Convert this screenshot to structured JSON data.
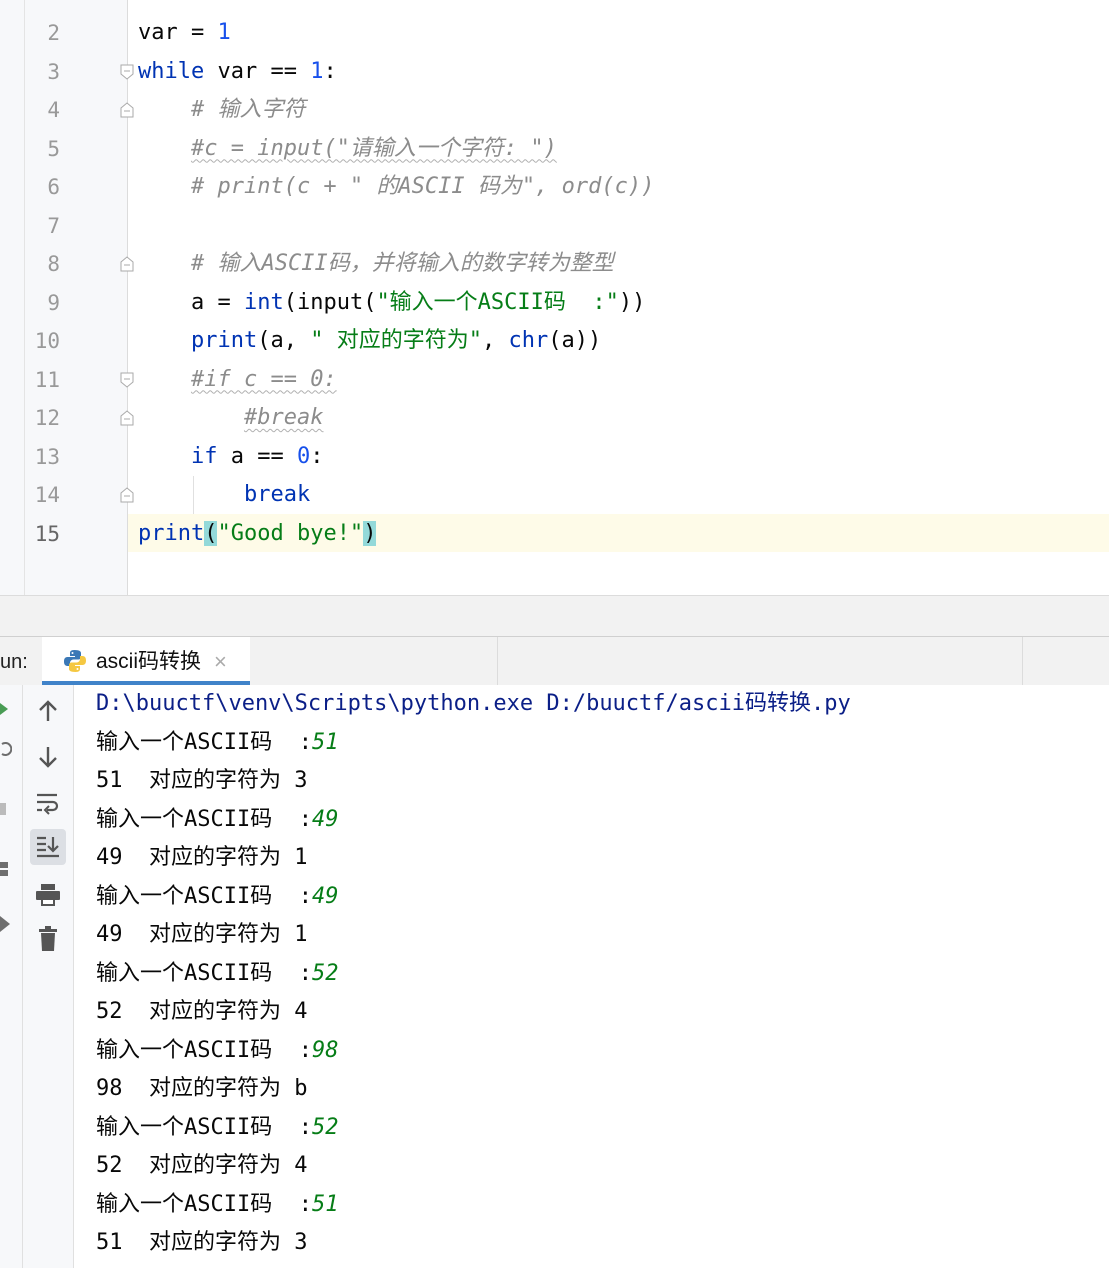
{
  "editor": {
    "current_line_number": "15",
    "lines": [
      {
        "n": "2",
        "segments": [
          {
            "t": "var = ",
            "c": ""
          },
          {
            "t": "1",
            "c": "num"
          }
        ]
      },
      {
        "n": "3",
        "segments": [
          {
            "t": "while",
            "c": "kw"
          },
          {
            "t": " var == ",
            "c": ""
          },
          {
            "t": "1",
            "c": "num"
          },
          {
            "t": ":",
            "c": ""
          }
        ]
      },
      {
        "n": "4",
        "segments": [
          {
            "t": "    # 输入字符",
            "c": "cm"
          }
        ]
      },
      {
        "n": "5",
        "segments": [
          {
            "t": "    ",
            "c": ""
          },
          {
            "t": "#c = input(\"请输入一个字符: \")",
            "c": "cm wavy"
          }
        ]
      },
      {
        "n": "6",
        "segments": [
          {
            "t": "    # print(c + \" 的ASCII 码为\", ord(c))",
            "c": "cm"
          }
        ]
      },
      {
        "n": "7",
        "segments": []
      },
      {
        "n": "8",
        "segments": [
          {
            "t": "    # 输入ASCII码，并将输入的数字转为整型",
            "c": "cm"
          }
        ]
      },
      {
        "n": "9",
        "segments": [
          {
            "t": "    a = ",
            "c": ""
          },
          {
            "t": "int",
            "c": "kw"
          },
          {
            "t": "(input(",
            "c": ""
          },
          {
            "t": "\"输入一个ASCII码  :\"",
            "c": "str"
          },
          {
            "t": "))",
            "c": ""
          }
        ]
      },
      {
        "n": "10",
        "segments": [
          {
            "t": "    ",
            "c": ""
          },
          {
            "t": "print",
            "c": "kw"
          },
          {
            "t": "(a, ",
            "c": ""
          },
          {
            "t": "\" 对应的字符为\"",
            "c": "str"
          },
          {
            "t": ", ",
            "c": ""
          },
          {
            "t": "chr",
            "c": "kw"
          },
          {
            "t": "(a))",
            "c": ""
          }
        ]
      },
      {
        "n": "11",
        "segments": [
          {
            "t": "    ",
            "c": ""
          },
          {
            "t": "#if c == 0:",
            "c": "cm wavy"
          }
        ]
      },
      {
        "n": "12",
        "segments": [
          {
            "t": "        ",
            "c": ""
          },
          {
            "t": "#break",
            "c": "cm wavy"
          }
        ]
      },
      {
        "n": "13",
        "segments": [
          {
            "t": "    ",
            "c": ""
          },
          {
            "t": "if",
            "c": "kw"
          },
          {
            "t": " a == ",
            "c": ""
          },
          {
            "t": "0",
            "c": "num"
          },
          {
            "t": ":",
            "c": ""
          }
        ]
      },
      {
        "n": "14",
        "segments": [
          {
            "t": "        ",
            "c": ""
          },
          {
            "t": "break",
            "c": "kw"
          }
        ]
      },
      {
        "n": "15",
        "segments": [
          {
            "t": "print",
            "c": "kw"
          },
          {
            "t": "(",
            "c": "bh"
          },
          {
            "t": "\"Good bye!\"",
            "c": "str"
          },
          {
            "t": ")",
            "c": "bh"
          }
        ]
      }
    ]
  },
  "run_panel": {
    "label": "un:",
    "tab_title": "ascii码转换",
    "tab_close": "×",
    "toolbar": [
      {
        "name": "up-arrow-icon",
        "active": false
      },
      {
        "name": "down-arrow-icon",
        "active": false
      },
      {
        "name": "soft-wrap-icon",
        "active": false
      },
      {
        "name": "scroll-to-end-icon",
        "active": true
      },
      {
        "name": "print-icon",
        "active": false
      },
      {
        "name": "trash-icon",
        "active": false
      }
    ]
  },
  "console": {
    "command": "D:\\buuctf\\venv\\Scripts\\python.exe D:/buuctf/ascii码转换.py",
    "prompt": "输入一个ASCII码  :",
    "entries": [
      {
        "input": "51",
        "output": "51  对应的字符为 3"
      },
      {
        "input": "49",
        "output": "49  对应的字符为 1"
      },
      {
        "input": "49",
        "output": "49  对应的字符为 1"
      },
      {
        "input": "52",
        "output": "52  对应的字符为 4"
      },
      {
        "input": "98",
        "output": "98  对应的字符为 b"
      },
      {
        "input": "52",
        "output": "52  对应的字符为 4"
      },
      {
        "input": "51",
        "output": "51  对应的字符为 3"
      }
    ]
  },
  "colors": {
    "keyword": "#0033b3",
    "number": "#1750eb",
    "string": "#067d17",
    "comment": "#8c8c8c",
    "current_line": "#fefbe8",
    "brace_highlight": "#93d9d9",
    "console_input": "#067d17",
    "tab_underline": "#4083c9"
  }
}
